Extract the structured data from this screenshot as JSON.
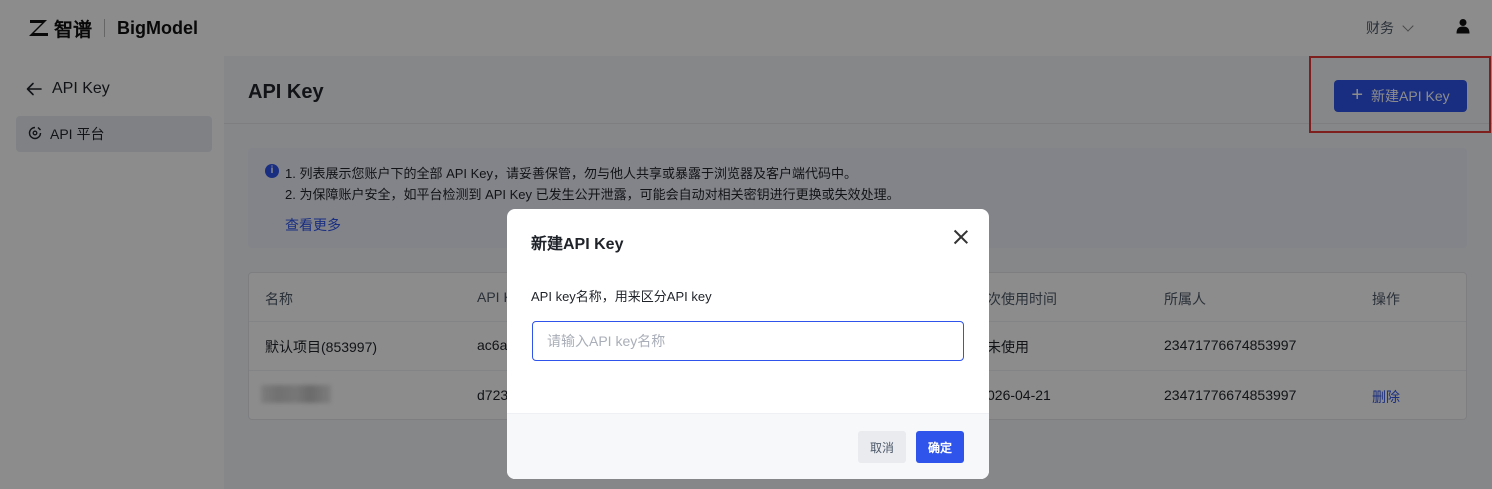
{
  "header": {
    "brand_cn": "智谱",
    "brand_en": "BigModel",
    "finance_menu": "财务"
  },
  "sidebar": {
    "back_label": "API Key",
    "items": [
      {
        "label": "API 平台"
      }
    ]
  },
  "main": {
    "title": "API Key",
    "new_button_label": "新建API Key",
    "notice": {
      "lines": [
        "1. 列表展示您账户下的全部 API Key，请妥善保管，勿与他人共享或暴露于浏览器及客户端代码中。",
        "2. 为保障账户安全，如平台检测到 API Key 已发生公开泄露，可能会自动对相关密钥进行更换或失效处理。"
      ],
      "see_more": "查看更多"
    },
    "table": {
      "columns": [
        "名称",
        "API K",
        "次使用时间",
        "所属人",
        "操作"
      ],
      "rows": [
        {
          "name": "默认项目(853997)",
          "key": "ac6a",
          "last_used": "未使用",
          "owner": "23471776674853997",
          "action": ""
        },
        {
          "name": "",
          "key": "d723",
          "last_used": "026-04-21",
          "owner": "23471776674853997",
          "action": "删除"
        }
      ]
    }
  },
  "modal": {
    "title": "新建API Key",
    "field_label": "API key名称，用来区分API key",
    "input_value": "",
    "input_placeholder": "请输入API key名称",
    "cancel_label": "取消",
    "confirm_label": "确定"
  },
  "colors": {
    "primary": "#2f54eb",
    "highlight": "#e53935"
  }
}
